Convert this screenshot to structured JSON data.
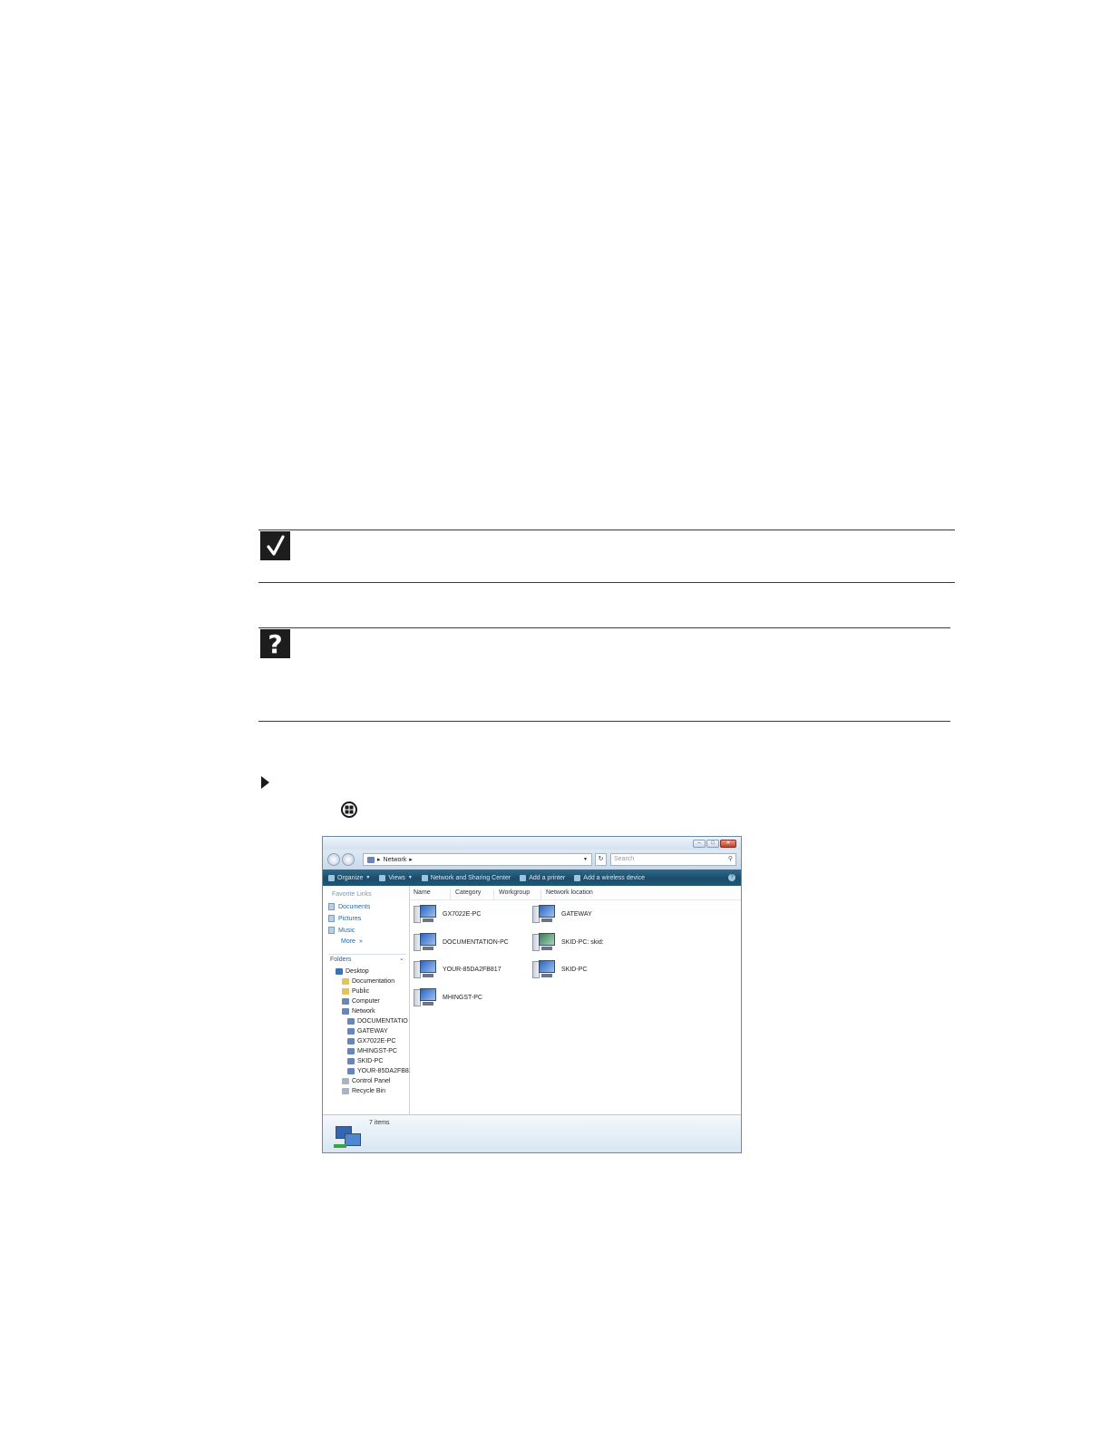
{
  "window": {
    "address": {
      "crumb": "Network"
    },
    "search_placeholder": "Search",
    "toolbar": {
      "organize": "Organize",
      "views": "Views",
      "network_center": "Network and Sharing Center",
      "add_printer": "Add a printer",
      "add_wireless": "Add a wireless device"
    },
    "favorites": {
      "heading": "Favorite Links",
      "links": [
        "Documents",
        "Pictures",
        "Music"
      ],
      "more": "More"
    },
    "folders": {
      "heading": "Folders",
      "tree": [
        "Desktop",
        "Documentation",
        "Public",
        "Computer",
        "Network",
        "DOCUMENTATIO",
        "GATEWAY",
        "GX7022E-PC",
        "MHINGST-PC",
        "SKID-PC",
        "YOUR-85DA2FB81",
        "Control Panel",
        "Recycle Bin"
      ]
    },
    "columns": [
      "Name",
      "Category",
      "Workgroup",
      "Network location"
    ],
    "computers": [
      "GX7022E-PC",
      "GATEWAY",
      "DOCUMENTATION-PC",
      "SKID-PC: skid:",
      "YOUR-85DA2FB817",
      "SKID-PC",
      "MHINGST-PC"
    ],
    "status": {
      "count": "7 items"
    }
  }
}
